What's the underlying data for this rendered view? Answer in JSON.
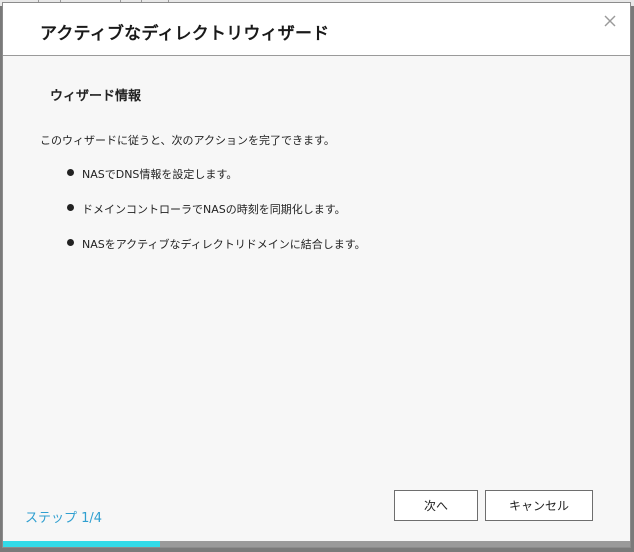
{
  "dialog": {
    "title": "アクティブなディレクトリウィザード",
    "close_icon": "close-icon"
  },
  "content": {
    "section_title": "ウィザード情報",
    "intro": "このウィザードに従うと、次のアクションを完了できます。",
    "bullets": [
      "NASでDNS情報を設定します。",
      "ドメインコントローラでNASの時刻を同期化します。",
      "NASをアクティブなディレクトリドメインに結合します。"
    ]
  },
  "footer": {
    "step_label": "ステップ 1/4",
    "next_label": "次へ",
    "cancel_label": "キャンセル",
    "progress": 0.25
  },
  "colors": {
    "accent": "#33dbe8",
    "step_text": "#2f9fd0"
  }
}
